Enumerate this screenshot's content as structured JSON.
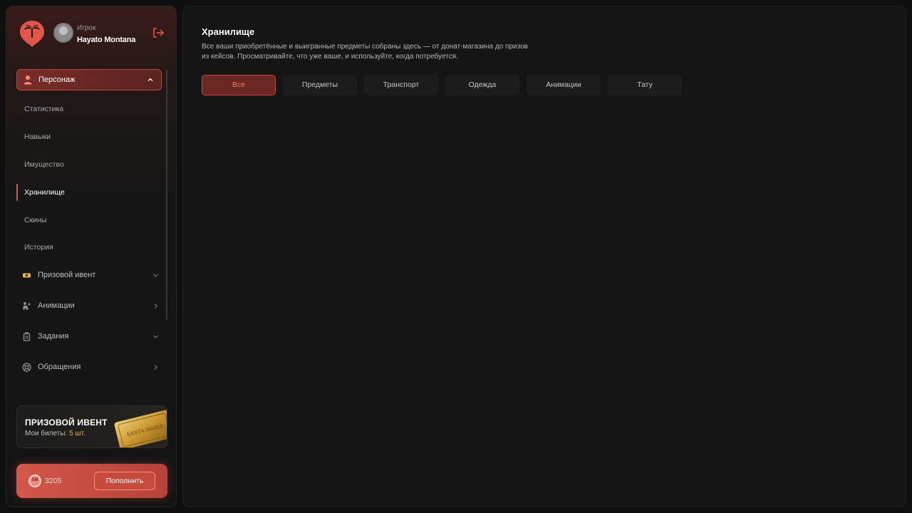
{
  "profile": {
    "role": "Игрок",
    "name": "Hayato Montana"
  },
  "nav": {
    "main_label": "Персонаж",
    "sub_items": [
      "Статистика",
      "Навыки",
      "Имущество",
      "Хранилище",
      "Скины",
      "История"
    ],
    "active_sub": "Хранилище",
    "items": [
      {
        "label": "Призовой ивент",
        "icon": "ticket-icon",
        "chevron": "down"
      },
      {
        "label": "Анимации",
        "icon": "animation-icon",
        "chevron": "right"
      },
      {
        "label": "Задания",
        "icon": "tasks-icon",
        "chevron": "down"
      },
      {
        "label": "Обращения",
        "icon": "support-icon",
        "chevron": "right"
      }
    ]
  },
  "event": {
    "title": "ПРИЗОВОЙ ИВЕНТ",
    "tickets_label": "Мои билеты:",
    "tickets_value": "5 шт.",
    "ticket_text": "SANTA MARIA"
  },
  "balance": {
    "coin_label": "SM",
    "value": "3205",
    "topup_label": "Пополнить"
  },
  "page": {
    "title": "Хранилище",
    "description": "Все ваши приобретённые и выигранные предметы собраны здесь — от донат-магазина до призов из кейсов. Просматривайте, что уже ваше, и используйте, когда потребуется.",
    "tabs": [
      "Все",
      "Предметы",
      "Транспорт",
      "Одежда",
      "Анимации",
      "Тату"
    ],
    "active_tab": "Все"
  },
  "colors": {
    "accent": "#d6584c",
    "gold": "#e7b54a",
    "background": "#0f0f0f"
  }
}
